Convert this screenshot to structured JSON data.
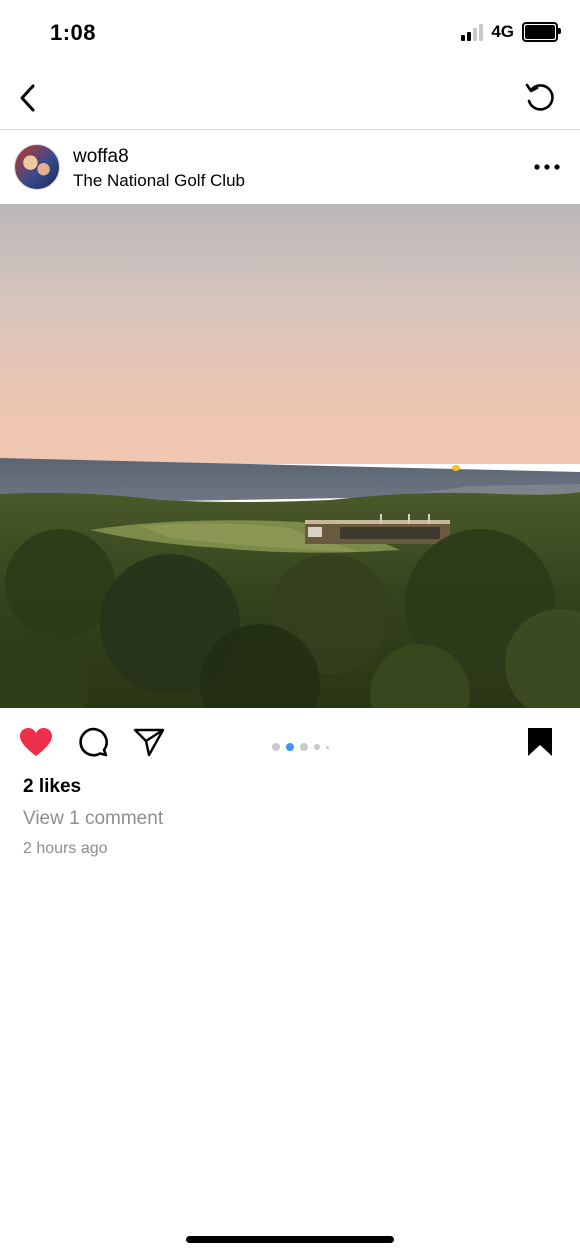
{
  "status_bar": {
    "time": "1:08",
    "network": "4G"
  },
  "nav": {
    "back_icon": "chevron-left-icon",
    "refresh_icon": "refresh-icon"
  },
  "post": {
    "username": "woffa8",
    "location": "The National Golf Club",
    "more_icon": "more-horizontal-icon",
    "likes_text": "2 likes",
    "comments_text": "View 1 comment",
    "timestamp": "2 hours ago",
    "liked": true,
    "saved": true,
    "carousel": {
      "total_visible_dots": 5,
      "active_index": 1
    }
  },
  "colors": {
    "like_red": "#ed2f4a",
    "carousel_active": "#3897f0",
    "secondary_text": "#8e8e8e"
  }
}
